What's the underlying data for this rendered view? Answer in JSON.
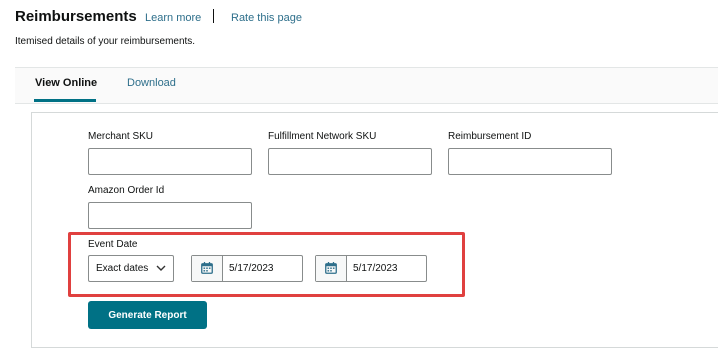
{
  "header": {
    "title": "Reimbursements",
    "learn_more": "Learn more",
    "rate_page": "Rate this page",
    "subtitle": "Itemised details of your reimbursements."
  },
  "tabs": [
    {
      "label": "View Online",
      "active": true
    },
    {
      "label": "Download",
      "active": false
    }
  ],
  "form": {
    "merchant_sku": {
      "label": "Merchant SKU",
      "value": ""
    },
    "fnsku": {
      "label": "Fulfillment Network SKU",
      "value": ""
    },
    "reimbursement_id": {
      "label": "Reimbursement ID",
      "value": ""
    },
    "amazon_order_id": {
      "label": "Amazon Order Id",
      "value": ""
    },
    "event_date": {
      "label": "Event Date",
      "mode": "Exact dates",
      "start_date": "5/17/2023",
      "end_date": "5/17/2023"
    },
    "generate_button": "Generate Report"
  },
  "colors": {
    "link": "#2e6f8b",
    "primary_button": "#007185",
    "highlight_border": "#e0403f"
  },
  "icons": {
    "calendar": "calendar-icon",
    "dropdown": "chevron-down-icon"
  }
}
